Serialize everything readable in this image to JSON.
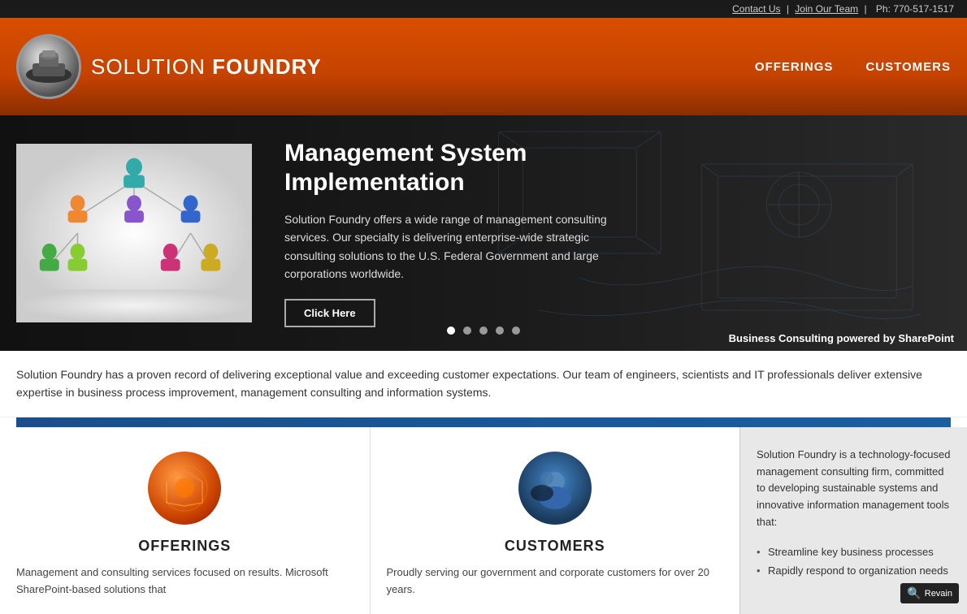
{
  "topbar": {
    "contact_label": "Contact Us",
    "join_label": "Join Our Team",
    "separator1": "|",
    "separator2": "|",
    "phone": "Ph: 770-517-1517"
  },
  "header": {
    "logo_text_part1": "SOLUTION ",
    "logo_text_part2": "FOUNDRY",
    "nav": {
      "offerings": "OFFERINGS",
      "customers": "CUSTOMERS"
    }
  },
  "hero": {
    "title": "Management System Implementation",
    "description": "Solution Foundry offers a wide range of management consulting services. Our specialty is delivering enterprise-wide strategic consulting solutions to the U.S. Federal Government and large corporations worldwide.",
    "cta_button": "Click Here",
    "footer_text_plain": "Business Consulting powered by ",
    "footer_text_bold": "SharePoint",
    "dots": [
      {
        "active": true
      },
      {
        "active": false
      },
      {
        "active": false
      },
      {
        "active": false
      },
      {
        "active": false
      }
    ]
  },
  "body_text": "Solution Foundry has a proven record of delivering exceptional value and exceeding customer expectations. Our team of engineers, scientists and IT professionals deliver extensive expertise in business process improvement, management consulting and information systems.",
  "cards": {
    "offerings": {
      "title": "OFFERINGS",
      "description": "Management and consulting services focused on results. Microsoft SharePoint-based solutions that"
    },
    "customers": {
      "title": "CUSTOMERS",
      "description": "Proudly serving our government and corporate customers for over 20 years."
    }
  },
  "right_panel": {
    "description": "Solution Foundry is a technology-focused management consulting firm, committed to developing sustainable systems and innovative information management tools that:",
    "bullets": [
      "Streamline key business processes",
      "Rapidly respond to organization needs"
    ]
  },
  "revain": {
    "label": "Revain"
  }
}
